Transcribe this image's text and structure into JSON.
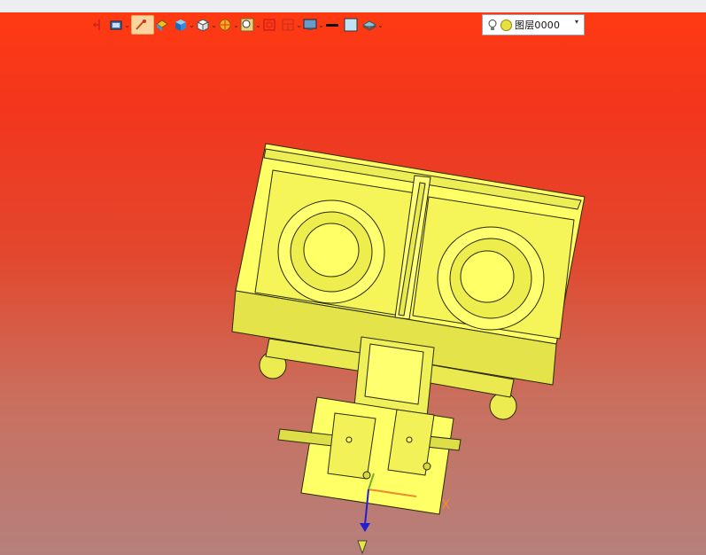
{
  "toolbar": {
    "tools": [
      {
        "name": "exit-view-icon",
        "dropdown": false
      },
      {
        "name": "render-style-icon",
        "dropdown": true
      },
      {
        "name": "edge-display-icon",
        "dropdown": false,
        "active": true
      },
      {
        "name": "shaded-solid-icon",
        "dropdown": false
      },
      {
        "name": "cube-view-icon",
        "dropdown": true
      },
      {
        "name": "iso-view-icon",
        "dropdown": true
      },
      {
        "name": "section-view-icon",
        "dropdown": true
      },
      {
        "name": "zoom-fit-icon",
        "dropdown": true
      },
      {
        "name": "rotate-icon",
        "dropdown": false
      },
      {
        "name": "layout-icon",
        "dropdown": true
      },
      {
        "name": "display-monitor-icon",
        "dropdown": true
      },
      {
        "name": "line-color-icon",
        "dropdown": false
      },
      {
        "name": "fill-color-icon",
        "dropdown": false
      },
      {
        "name": "layer-stack-icon",
        "dropdown": true
      }
    ],
    "dropdown_glyph": "⌄",
    "layer": {
      "label": "图层0000",
      "arrow": "▾"
    }
  },
  "viewport": {
    "axis_x_label": "X",
    "model_color": "#ffff66",
    "background_top": "#ff3a12",
    "background_bottom": "#b5807c"
  }
}
